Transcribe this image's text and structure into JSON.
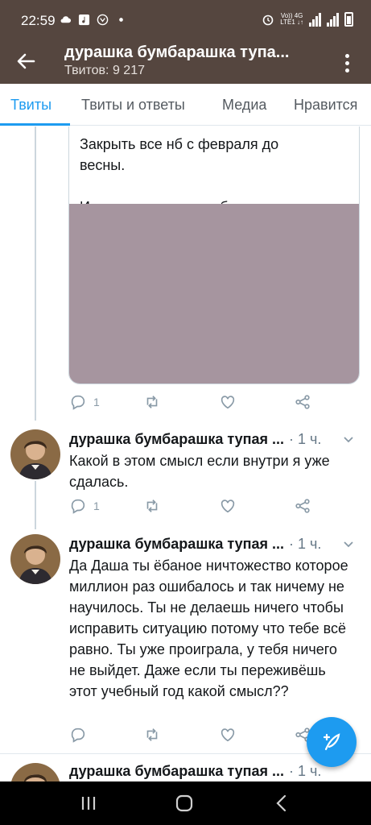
{
  "status_bar": {
    "time": "22:59",
    "network_top": "Vo)) 4G",
    "network_bottom": "LTE1 ↓↑"
  },
  "app_bar": {
    "title": "дурашка бумбарашка тупа...",
    "subtitle": "Твитов: 9 217"
  },
  "tabs": [
    {
      "label": "Твиты",
      "active": true
    },
    {
      "label": "Твиты и ответы",
      "active": false
    },
    {
      "label": "Медиа",
      "active": false
    },
    {
      "label": "Нравится",
      "active": false
    }
  ],
  "card": {
    "line1": "Закрыть все нб с февраля до",
    "line2": "весны.",
    "line3": "Итак, затравочка чтобы мотивиро...",
    "image_color": "#a6959f"
  },
  "card_actions": {
    "reply_count": "1"
  },
  "tweets": [
    {
      "name": "дурашка бумбарашка тупая ...",
      "time": "· 1 ч.",
      "text": "Какой в этом смысл если внутри я уже сдалась.",
      "reply_count": "1"
    },
    {
      "name": "дурашка бумбарашка тупая ...",
      "time": "· 1 ч.",
      "text": "Да Даша ты ёбаное ничтожество которое миллион раз ошибалось и так ничему не научилось. Ты не делаешь ничего чтобы исправить ситуацию потому что тебе всё равно. Ты уже проиграла, у тебя ничего не выйдет. Даже если ты переживёшь этот учебный год какой смысл??",
      "reply_count": ""
    },
    {
      "name": "дурашка бумбарашка тупая ...",
      "time": "· 1 ч."
    }
  ],
  "colors": {
    "header_bg": "#55463f",
    "accent": "#1d9bf0",
    "muted": "#8899a6"
  }
}
